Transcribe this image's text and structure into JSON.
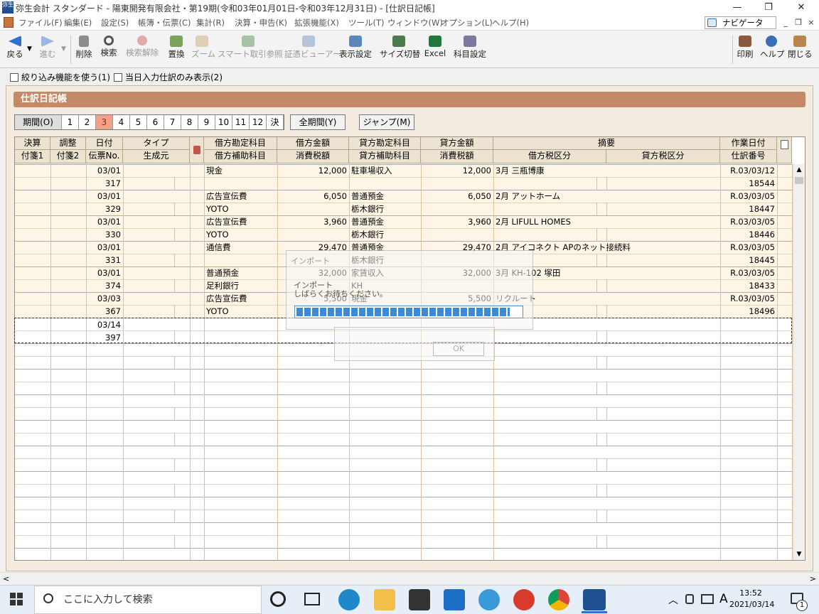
{
  "window": {
    "title": "弥生会計 スタンダード - 陽東開発有限会社・第19期(令和03年01月01日-令和03年12月31日) - [仕訳日記帳]",
    "app_icon_text": "弥生",
    "minimize": "—",
    "restore": "❐",
    "close": "✕"
  },
  "menu": {
    "items": [
      "ファイル(F)",
      "編集(E)",
      "設定(S)",
      "帳簿・伝票(C)",
      "集計(R)",
      "決算・申告(K)",
      "拡張機能(X)",
      "ツール(T)",
      "ウィンドウ(W)",
      "オプション(L)",
      "ヘルプ(H)"
    ],
    "navigator": "ナビゲータ",
    "mdi_minimize": "_",
    "mdi_restore": "❐",
    "mdi_close": "×"
  },
  "toolbar": {
    "back": "戻る",
    "forward": "進む",
    "delete": "削除",
    "search": "検索",
    "search_clear": "検索解除",
    "replace": "置換",
    "zoom": "ズーム",
    "smart_ref": "スマート取引参照",
    "voucher_viewer": "証憑ビューアー",
    "display_settings": "表示設定",
    "size_switch": "サイズ切替",
    "excel": "Excel",
    "account_settings": "科目設定",
    "print": "印刷",
    "help": "ヘルプ",
    "close": "閉じる"
  },
  "filters": {
    "narrow": "絞り込み機能を使う(1)",
    "today_only": "当日入力仕訳のみ表示(2)"
  },
  "book": {
    "title": "仕訳日記帳"
  },
  "period": {
    "label": "期間(O)",
    "months": [
      "1",
      "2",
      "3",
      "4",
      "5",
      "6",
      "7",
      "8",
      "9",
      "10",
      "11",
      "12",
      "決"
    ],
    "selected": "3",
    "all_period": "全期間(Y)",
    "jump": "ジャンプ(M)"
  },
  "table": {
    "header_row1": [
      "決算",
      "調整",
      "日付",
      "タイプ",
      "借方勘定科目",
      "借方金額",
      "貸方勘定科目",
      "貸方金額",
      "摘要",
      "作業日付"
    ],
    "header_row2": [
      "付箋1",
      "付箋2",
      "伝票No.",
      "生成元",
      "借方補助科目",
      "消費税額",
      "貸方補助科目",
      "消費税額",
      "借方税区分",
      "貸方税区分",
      "仕訳番号"
    ],
    "entries": [
      {
        "date": "03/01",
        "no": "317",
        "dr": "現金",
        "dr_sub": "",
        "dr_amt": "12,000",
        "cr": "駐車場収入",
        "cr_sub": "",
        "cr_amt": "12,000",
        "memo": "3月  三瓶博康",
        "work_date": "R.03/03/12",
        "serial": "18544"
      },
      {
        "date": "03/01",
        "no": "329",
        "dr": "広告宣伝費",
        "dr_sub": "YOTO",
        "dr_amt": "6,050",
        "cr": "普通預金",
        "cr_sub": "栃木銀行",
        "cr_amt": "6,050",
        "memo": "2月  アットホーム",
        "work_date": "R.03/03/05",
        "serial": "18447"
      },
      {
        "date": "03/01",
        "no": "330",
        "dr": "広告宣伝費",
        "dr_sub": "YOTO",
        "dr_amt": "3,960",
        "cr": "普通預金",
        "cr_sub": "栃木銀行",
        "cr_amt": "3,960",
        "memo": "2月  LIFULL  HOMES",
        "work_date": "R.03/03/05",
        "serial": "18446"
      },
      {
        "date": "03/01",
        "no": "331",
        "dr": "通信費",
        "dr_sub": "",
        "dr_amt": "29,470",
        "cr": "普通預金",
        "cr_sub": "栃木銀行",
        "cr_amt": "29,470",
        "memo": "2月  アイコネクト APのネット接続料",
        "work_date": "R.03/03/05",
        "serial": "18445"
      },
      {
        "date": "03/01",
        "no": "374",
        "dr": "普通預金",
        "dr_sub": "足利銀行",
        "dr_amt": "32,000",
        "cr": "家賃収入",
        "cr_sub": "KH",
        "cr_amt": "32,000",
        "memo": "3月  KH-102 塚田",
        "work_date": "R.03/03/05",
        "serial": "18433"
      },
      {
        "date": "03/03",
        "no": "367",
        "dr": "広告宣伝費",
        "dr_sub": "YOTO",
        "dr_amt": "5,500",
        "cr": "現金",
        "cr_sub": "",
        "cr_amt": "5,500",
        "memo": "リクルート",
        "work_date": "R.03/03/05",
        "serial": "18496"
      },
      {
        "date": "03/14",
        "no": "397",
        "dr": "",
        "dr_sub": "",
        "dr_amt": "",
        "cr": "",
        "cr_sub": "",
        "cr_amt": "",
        "memo": "",
        "work_date": "",
        "serial": ""
      }
    ]
  },
  "import_dialog": {
    "title": "インポート",
    "heading": "インポート",
    "message": "しばらくお待ちください。",
    "progress": 0.95,
    "ok": "OK"
  },
  "taskbar": {
    "search_placeholder": "ここに入力して検索",
    "ime": "A",
    "time": "13:52",
    "date": "2021/03/14",
    "notifications": "1"
  },
  "colors": {
    "accent_header": "#c48a68",
    "selected_month": "#f3a188",
    "row_band": "#fdf6e7",
    "progress": "#3a8ad6"
  }
}
